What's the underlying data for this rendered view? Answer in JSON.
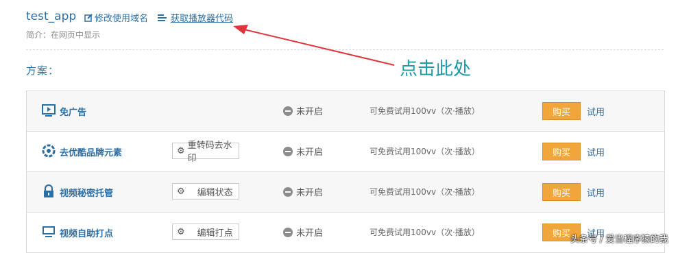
{
  "header": {
    "app_name": "test_app",
    "edit_domain_label": "修改使用域名",
    "get_code_label": "获取播放器代码",
    "intro": "简介：在网页中显示"
  },
  "plans_heading": "方案：",
  "annotation": {
    "text": "点击此处",
    "color": "#1f9aa6",
    "arrow_color": "#e0353a"
  },
  "rows": [
    {
      "name": "免广告",
      "icon": "play-screen-icon",
      "action": "",
      "status": "未开启",
      "trial": "可免费试用100vv（次·播放）",
      "buy": "购买",
      "try": "试用"
    },
    {
      "name": "去优酷品牌元素",
      "icon": "shutter-icon",
      "action": "重转码去水印",
      "status": "未开启",
      "trial": "可免费试用100vv（次·播放）",
      "buy": "购买",
      "try": "试用"
    },
    {
      "name": "视频秘密托管",
      "icon": "lock-icon",
      "action": "编辑状态",
      "status": "未开启",
      "trial": "可免费试用100vv（次·播放）",
      "buy": "购买",
      "try": "试用"
    },
    {
      "name": "视频自助打点",
      "icon": "monitor-icon",
      "action": "编辑打点",
      "status": "未开启",
      "trial": "可免费试用100vv（次·播放）",
      "buy": "购买",
      "try": "试用"
    }
  ],
  "watermark": "头条号 / 爱当程序猿的我",
  "colors": {
    "link": "#2c6fa5",
    "buy": "#f0a63a"
  }
}
